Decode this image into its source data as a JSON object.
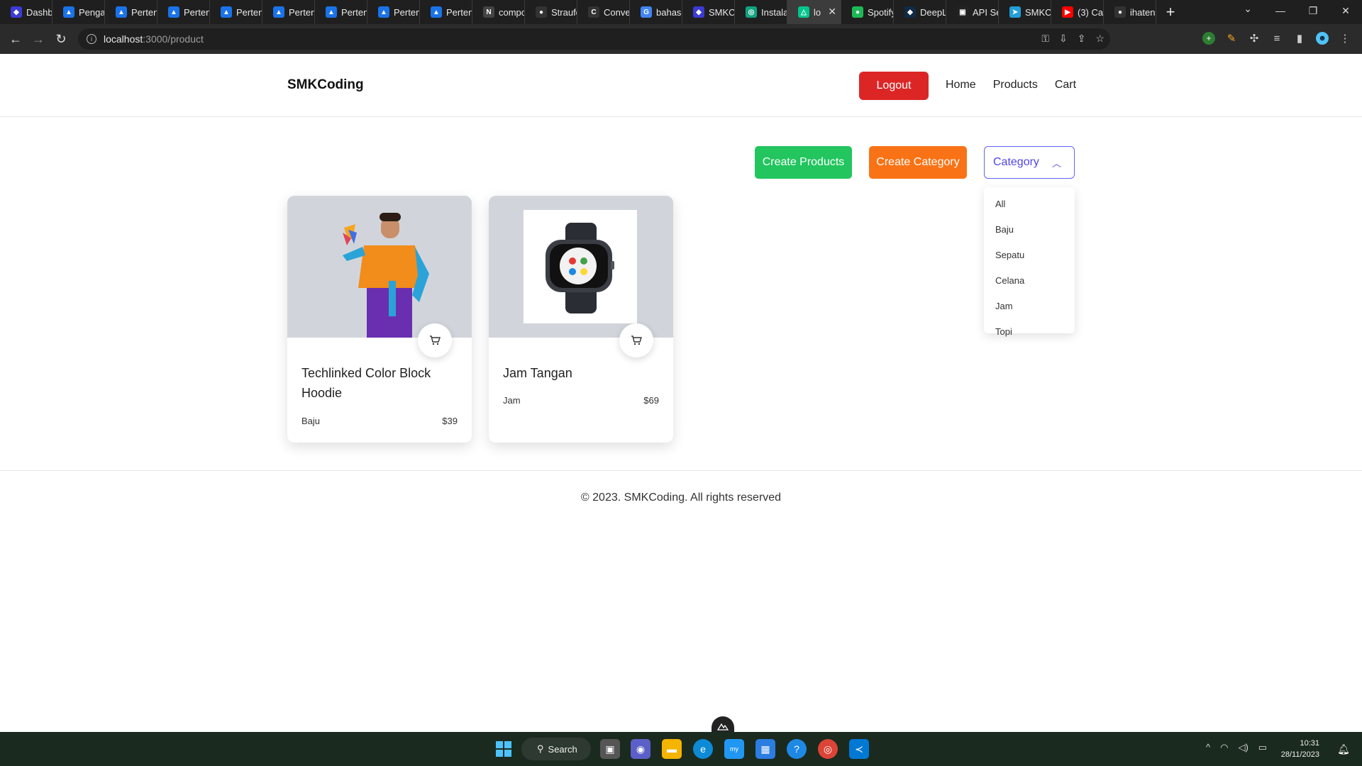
{
  "browser": {
    "tabs": [
      {
        "label": "Dashb",
        "color": "#3b3bd6",
        "glyph": "◆"
      },
      {
        "label": "Penga",
        "color": "#1a73e8",
        "glyph": "▲"
      },
      {
        "label": "Perten",
        "color": "#1a73e8",
        "glyph": "▲"
      },
      {
        "label": "Perten",
        "color": "#1a73e8",
        "glyph": "▲"
      },
      {
        "label": "Perten",
        "color": "#1a73e8",
        "glyph": "▲"
      },
      {
        "label": "Perten",
        "color": "#1a73e8",
        "glyph": "▲"
      },
      {
        "label": "Perten",
        "color": "#1a73e8",
        "glyph": "▲"
      },
      {
        "label": "Perten",
        "color": "#1a73e8",
        "glyph": "▲"
      },
      {
        "label": "Perten",
        "color": "#1a73e8",
        "glyph": "▲"
      },
      {
        "label": "compc",
        "color": "#444",
        "glyph": "N"
      },
      {
        "label": "Straufe",
        "color": "#333",
        "glyph": "●"
      },
      {
        "label": "Conve",
        "color": "#333",
        "glyph": "C"
      },
      {
        "label": "bahas",
        "color": "#4285f4",
        "glyph": "G"
      },
      {
        "label": "SMKCo",
        "color": "#3b3bd6",
        "glyph": "◆"
      },
      {
        "label": "Instala",
        "color": "#10a37f",
        "glyph": "◎"
      },
      {
        "label": "lo",
        "color": "#00c58e",
        "glyph": "△",
        "active": true
      },
      {
        "label": "Spotify",
        "color": "#1db954",
        "glyph": "●"
      },
      {
        "label": "DeepL",
        "color": "#0f2b46",
        "glyph": "◆"
      },
      {
        "label": "API Se",
        "color": "#222",
        "glyph": "▣"
      },
      {
        "label": "SMKCo",
        "color": "#229ed9",
        "glyph": "➤"
      },
      {
        "label": "(3) Car",
        "color": "#ff0000",
        "glyph": "▶"
      },
      {
        "label": "ihaten",
        "color": "#333",
        "glyph": "●"
      }
    ],
    "url_host": "localhost",
    "url_path": ":3000/product"
  },
  "site": {
    "brand": "SMKCoding",
    "logout_label": "Logout",
    "nav": [
      "Home",
      "Products",
      "Cart"
    ],
    "create_products_label": "Create Products",
    "create_category_label": "Create Category",
    "category_select_label": "Category",
    "category_options": [
      "All",
      "Baju",
      "Sepatu",
      "Celana",
      "Jam",
      "Topi"
    ],
    "products": [
      {
        "title": "Techlinked Color Block Hoodie",
        "category": "Baju",
        "price": "$39"
      },
      {
        "title": "Jam Tangan",
        "category": "Jam",
        "price": "$69"
      }
    ],
    "footer": "© 2023. SMKCoding. All rights reserved"
  },
  "taskbar": {
    "search_label": "Search",
    "time": "10:31",
    "date": "28/11/2023"
  },
  "colors": {
    "logout": "#dc2626",
    "create_products": "#22c55e",
    "create_category": "#f97316",
    "category_border": "#6366f1"
  }
}
